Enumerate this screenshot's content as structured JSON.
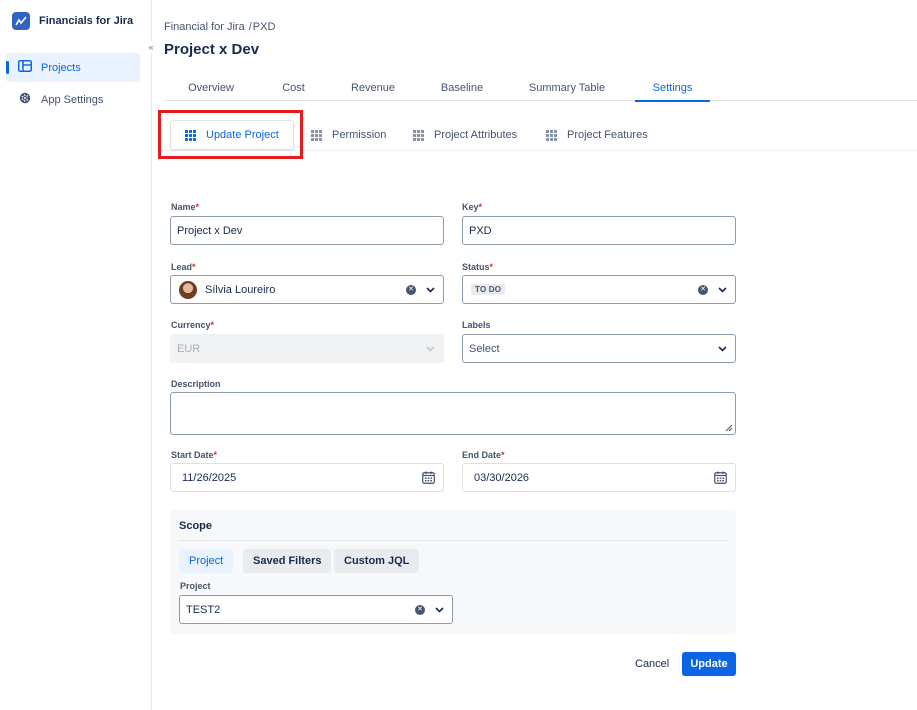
{
  "app": {
    "title": "Financials for Jira"
  },
  "sidebar": {
    "items": [
      {
        "label": "Projects",
        "icon": "board-icon",
        "active": true
      },
      {
        "label": "App Settings",
        "icon": "gear-icon",
        "active": false
      }
    ]
  },
  "breadcrumb": {
    "root": "Financial for Jira",
    "separator": "/",
    "current": "PXD"
  },
  "page": {
    "title": "Project x Dev"
  },
  "tabs": [
    {
      "label": "Overview"
    },
    {
      "label": "Cost"
    },
    {
      "label": "Revenue"
    },
    {
      "label": "Baseline"
    },
    {
      "label": "Summary Table"
    },
    {
      "label": "Settings",
      "active": true
    }
  ],
  "subtabs": [
    {
      "label": "Update Project",
      "active": true
    },
    {
      "label": "Permission"
    },
    {
      "label": "Project Attributes"
    },
    {
      "label": "Project Features"
    }
  ],
  "form": {
    "required_mark": "*",
    "name": {
      "label": "Name",
      "value": "Project x Dev"
    },
    "key": {
      "label": "Key",
      "value": "PXD"
    },
    "lead": {
      "label": "Lead",
      "value": "Sílvia Loureiro"
    },
    "status": {
      "label": "Status",
      "value": "TO DO"
    },
    "currency": {
      "label": "Currency",
      "value": "EUR"
    },
    "labels": {
      "label": "Labels",
      "placeholder": "Select"
    },
    "description": {
      "label": "Description",
      "value": ""
    },
    "start_date": {
      "label": "Start Date",
      "value": "11/26/2025"
    },
    "end_date": {
      "label": "End Date",
      "value": "03/30/2026"
    }
  },
  "scope": {
    "title": "Scope",
    "options": [
      {
        "label": "Project",
        "active": true
      },
      {
        "label": "Saved Filters"
      },
      {
        "label": "Custom JQL"
      }
    ],
    "project_label": "Project",
    "project_value": "TEST2"
  },
  "actions": {
    "cancel": "Cancel",
    "update": "Update"
  },
  "colors": {
    "accent": "#0c66e4",
    "highlight": "#e31d1d",
    "required": "#c9372c"
  }
}
